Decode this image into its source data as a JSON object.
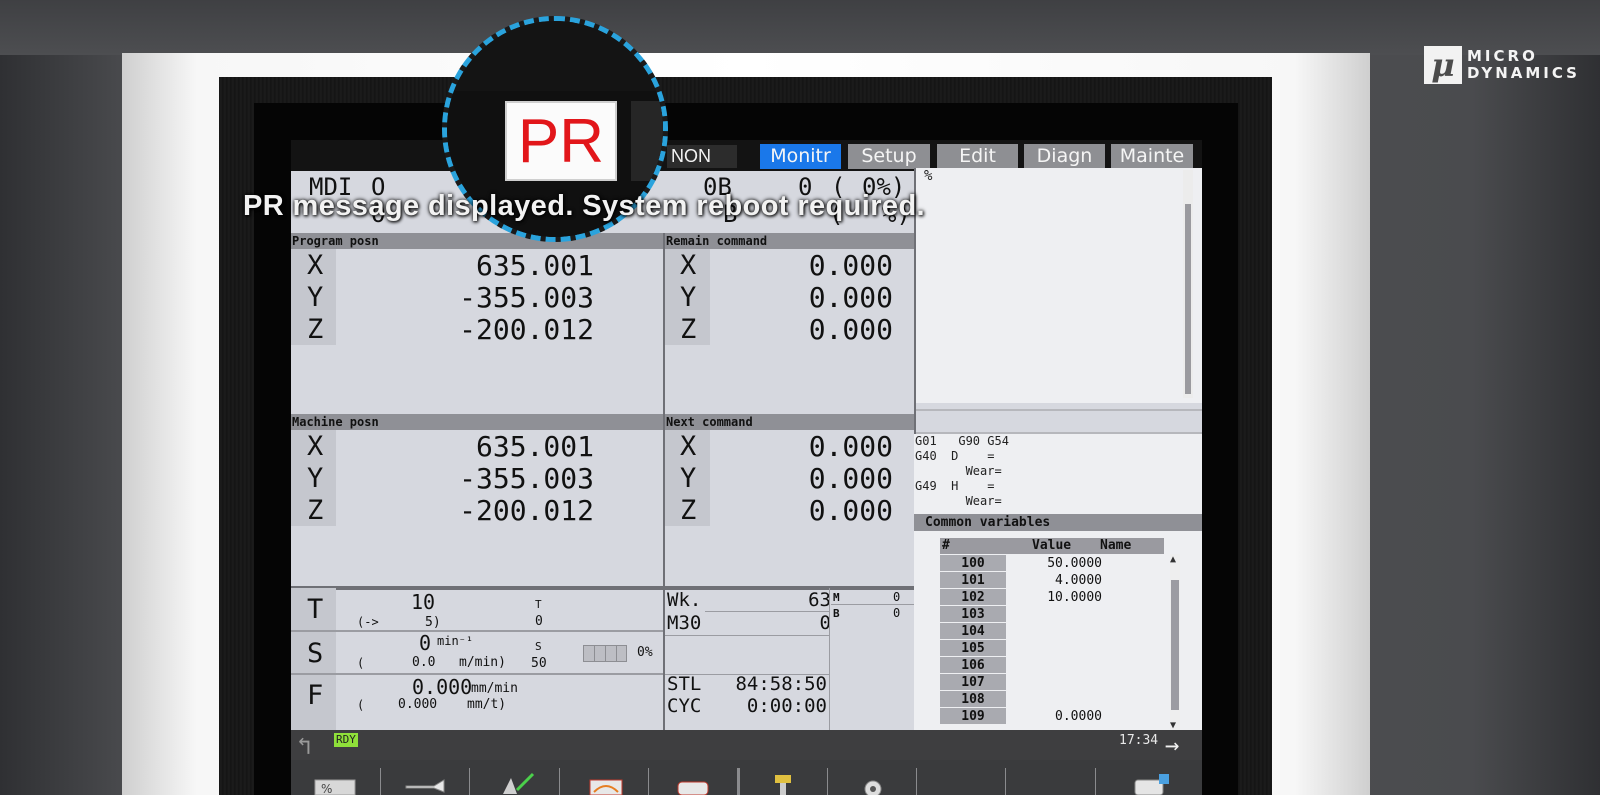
{
  "brand": {
    "logo_mark": "μ",
    "line1": "MICRO",
    "line2": "DYNAMICS"
  },
  "overlay": {
    "message": "PR message displayed. System reboot required.",
    "zoom_code": "PR"
  },
  "topbar": {
    "mode": "NON",
    "tabs": [
      "Monitr",
      "Setup",
      "Edit",
      "Diagn",
      "Mainte"
    ],
    "active_tab": "Monitr"
  },
  "header": {
    "line1": {
      "mode": "MDI",
      "prog": "O",
      "block": "0B",
      "n": "0",
      "paren": "(",
      "pct": "0%)"
    },
    "line2": {
      "prog": "O",
      "block": "B",
      "paren": "(",
      "pct": "%)"
    }
  },
  "program_posn": {
    "title": "Program posn",
    "axes": [
      {
        "label": "X",
        "value": "635.001"
      },
      {
        "label": "Y",
        "value": "-355.003"
      },
      {
        "label": "Z",
        "value": "-200.012"
      }
    ]
  },
  "remain_command": {
    "title": "Remain command",
    "axes": [
      {
        "label": "X",
        "value": "0.000"
      },
      {
        "label": "Y",
        "value": "0.000"
      },
      {
        "label": "Z",
        "value": "0.000"
      }
    ]
  },
  "machine_posn": {
    "title": "Machine posn",
    "axes": [
      {
        "label": "X",
        "value": "635.001"
      },
      {
        "label": "Y",
        "value": "-355.003"
      },
      {
        "label": "Z",
        "value": "-200.012"
      }
    ]
  },
  "next_command": {
    "title": "Next command",
    "axes": [
      {
        "label": "X",
        "value": "0.000"
      },
      {
        "label": "Y",
        "value": "0.000"
      },
      {
        "label": "Z",
        "value": "0.000"
      }
    ]
  },
  "editor": {
    "text": "%"
  },
  "modal": {
    "line1": "G01   G90 G54",
    "line2": "G40  D    =",
    "line3": "       Wear=",
    "line4": "G49  H    =",
    "line5": "       Wear="
  },
  "common_variables": {
    "title": "Common variables",
    "headers": {
      "num": "#",
      "value": "Value",
      "name": "Name"
    },
    "rows": [
      {
        "num": "100",
        "value": "50.0000"
      },
      {
        "num": "101",
        "value": "4.0000"
      },
      {
        "num": "102",
        "value": "10.0000"
      },
      {
        "num": "103",
        "value": ""
      },
      {
        "num": "104",
        "value": ""
      },
      {
        "num": "105",
        "value": ""
      },
      {
        "num": "106",
        "value": ""
      },
      {
        "num": "107",
        "value": ""
      },
      {
        "num": "108",
        "value": ""
      },
      {
        "num": "109",
        "value": "0.0000"
      }
    ],
    "scroll_up": "▲",
    "scroll_down": "▼"
  },
  "tool": {
    "label": "T",
    "value": "10",
    "arrow": "(->",
    "next": "5)",
    "t_label": "T",
    "t_value": "0"
  },
  "spindle": {
    "label": "S",
    "value": "0",
    "unit": "min⁻¹",
    "paren": "(",
    "speed": "0.0",
    "speed_unit": "m/min)",
    "s_label": "S",
    "s_value": "50",
    "override": "0%"
  },
  "feed": {
    "label": "F",
    "value": "0.000",
    "unit": "mm/min",
    "paren": "(",
    "per_rev": "0.000",
    "per_rev_unit": "mm/t)"
  },
  "counters": {
    "wk_label": "Wk.",
    "wk_value": "63",
    "m30_label": "M30",
    "m30_value": "0",
    "m_label": "M",
    "m_value": "0",
    "b_label": "B",
    "b_value": "0"
  },
  "times": {
    "stl_label": "STL",
    "stl_value": "84:58:50",
    "cyc_label": "CYC",
    "cyc_value": "0:00:00"
  },
  "status": {
    "ready": "RDY",
    "time": "17:34",
    "next_arrow": "→",
    "back_arrow": "↰"
  },
  "colors": {
    "accent_tab": "#1a78ea",
    "ready": "#8fe03a",
    "pr_red": "#e2161a",
    "callout": "#2aa3dd"
  }
}
